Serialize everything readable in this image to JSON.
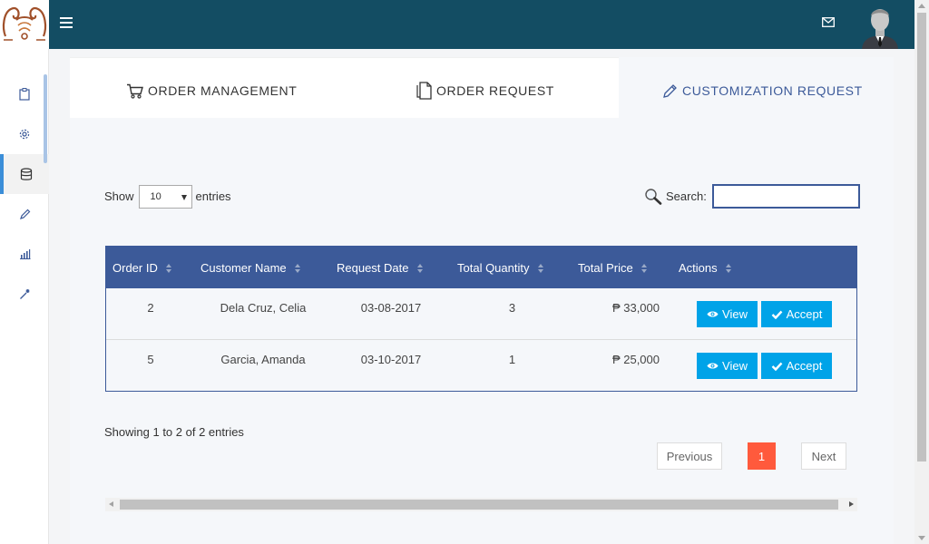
{
  "topbar": {
    "background": "#134d63"
  },
  "tabs": [
    {
      "label": "ORDER MANAGEMENT",
      "icon": "cart-icon"
    },
    {
      "label": "ORDER REQUEST",
      "icon": "document-icon"
    },
    {
      "label": "CUSTOMIZATION REQUEST",
      "icon": "pencil-icon",
      "active": true
    }
  ],
  "sidebar": {
    "items": [
      {
        "icon": "clipboard-icon"
      },
      {
        "icon": "gear-icon"
      },
      {
        "icon": "database-icon",
        "active": true
      },
      {
        "icon": "pencil-icon"
      },
      {
        "icon": "bar-chart-icon"
      },
      {
        "icon": "magic-wand-icon"
      }
    ]
  },
  "table_controls": {
    "show_label": "Show",
    "entries_label": "entries",
    "page_length": "10",
    "search_label": "Search:",
    "search_value": ""
  },
  "table": {
    "columns": [
      "Order ID",
      "Customer Name",
      "Request Date",
      "Total Quantity",
      "Total Price",
      "Actions"
    ],
    "rows": [
      {
        "order_id": "2",
        "customer": "Dela Cruz, Celia",
        "date": "03-08-2017",
        "quantity": "3",
        "price": "₱ 33,000"
      },
      {
        "order_id": "5",
        "customer": "Garcia, Amanda",
        "date": "03-10-2017",
        "quantity": "1",
        "price": "₱ 25,000"
      }
    ],
    "view_label": "View",
    "accept_label": "Accept"
  },
  "footer": {
    "info": "Showing 1 to 2 of 2 entries",
    "previous": "Previous",
    "current_page": "1",
    "next": "Next"
  },
  "colors": {
    "header": "#3c5a99",
    "action_button": "#00a3e8",
    "active_page": "#ff5a3c"
  }
}
